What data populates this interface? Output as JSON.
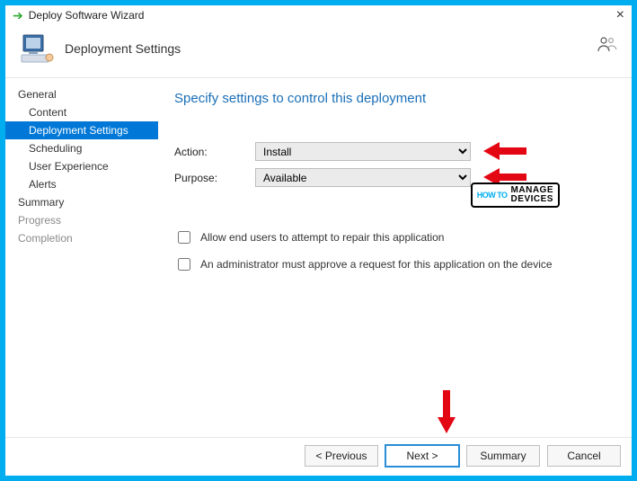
{
  "window": {
    "title": "Deploy Software Wizard"
  },
  "header": {
    "page_title": "Deployment Settings"
  },
  "sidebar": {
    "items": [
      {
        "label": "General",
        "level": "top",
        "selected": false,
        "muted": false
      },
      {
        "label": "Content",
        "level": "sub",
        "selected": false,
        "muted": false
      },
      {
        "label": "Deployment Settings",
        "level": "sub",
        "selected": true,
        "muted": false
      },
      {
        "label": "Scheduling",
        "level": "sub",
        "selected": false,
        "muted": false
      },
      {
        "label": "User Experience",
        "level": "sub",
        "selected": false,
        "muted": false
      },
      {
        "label": "Alerts",
        "level": "sub",
        "selected": false,
        "muted": false
      },
      {
        "label": "Summary",
        "level": "top",
        "selected": false,
        "muted": false
      },
      {
        "label": "Progress",
        "level": "top",
        "selected": false,
        "muted": true
      },
      {
        "label": "Completion",
        "level": "top",
        "selected": false,
        "muted": true
      }
    ]
  },
  "main": {
    "heading": "Specify settings to control this deployment",
    "form": {
      "action_label": "Action:",
      "action_value": "Install",
      "purpose_label": "Purpose:",
      "purpose_value": "Available"
    },
    "checkboxes": {
      "repair_checked": false,
      "repair_label": "Allow end users to attempt to repair this application",
      "approve_checked": false,
      "approve_label": "An administrator must approve a request for this application on the device"
    }
  },
  "footer": {
    "previous": "< Previous",
    "next": "Next >",
    "summary": "Summary",
    "cancel": "Cancel"
  },
  "watermark": {
    "howto": "HOW TO",
    "line1": "MANAGE",
    "line2": "DEVICES"
  }
}
